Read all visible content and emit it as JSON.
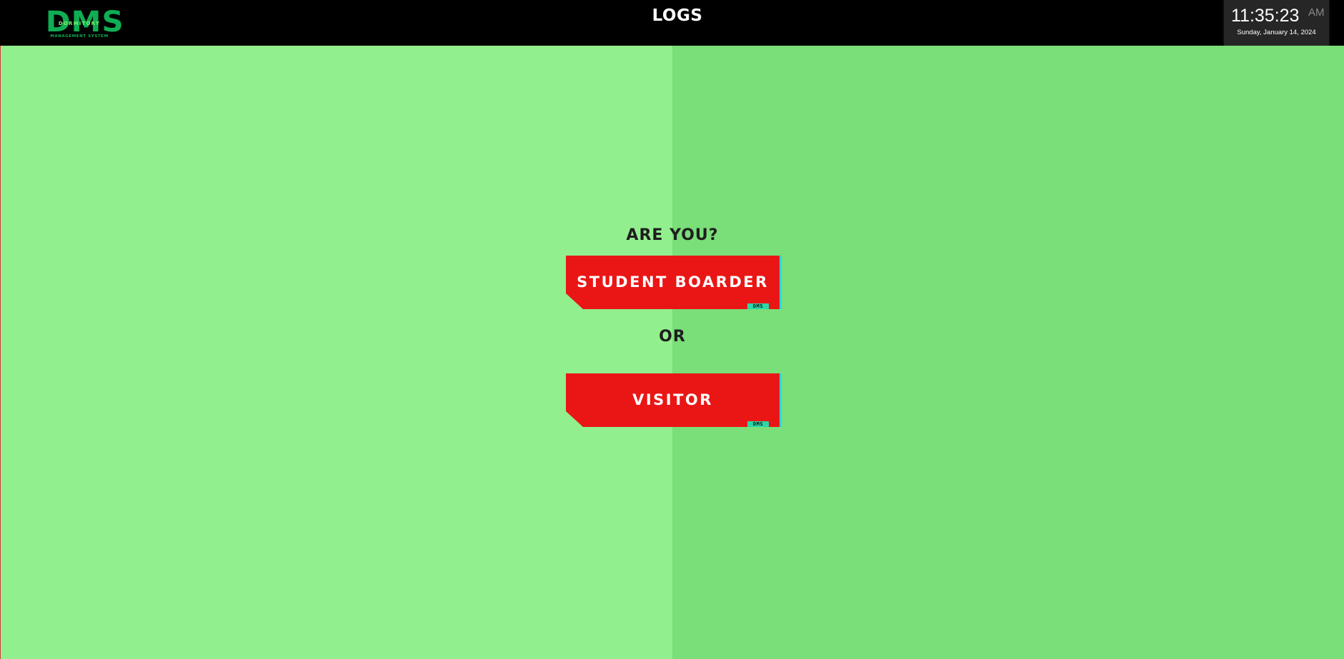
{
  "header": {
    "logo": {
      "main": "DMS",
      "over": "DORMITORY",
      "sub": "MANAGEMENT SYSTEM"
    },
    "title": "LOGS",
    "clock": {
      "time": "11:35:23",
      "ampm": "AM",
      "date": "Sunday, January 14, 2024"
    }
  },
  "main": {
    "question": "ARE YOU?",
    "or": "OR",
    "buttons": [
      {
        "label": "STUDENT BOARDER",
        "tag": "DMS"
      },
      {
        "label": "VISITOR",
        "tag": "DMS"
      }
    ]
  },
  "colors": {
    "header_bg": "#000000",
    "left_bg": "#92ef8e",
    "right_bg": "#7ade79",
    "button_red": "#ea1616",
    "button_edge": "#2ad7e0",
    "logo_green": "#0fae54"
  }
}
